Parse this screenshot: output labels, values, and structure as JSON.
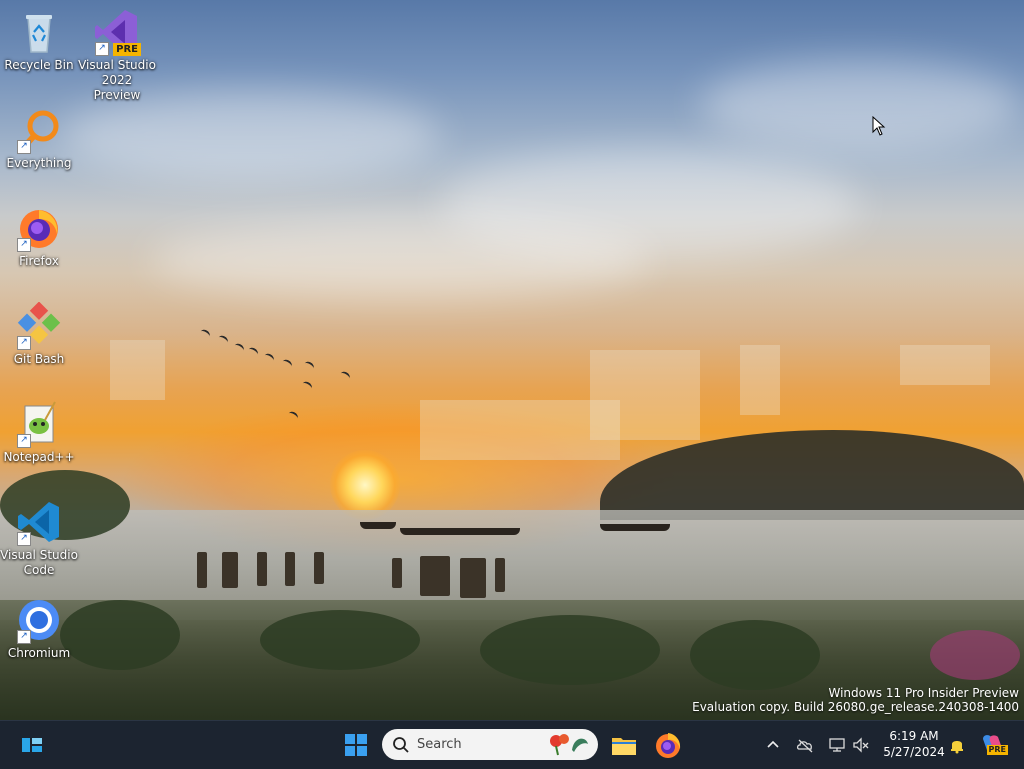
{
  "desktop_icons": [
    {
      "label": "Recycle Bin",
      "icon": "recycle-bin-icon",
      "shortcut": false
    },
    {
      "label": "Visual Studio 2022 Preview",
      "icon": "visual-studio-preview-icon",
      "badge": "PRE",
      "shortcut": true
    },
    {
      "label": "Everything",
      "icon": "everything-search-icon",
      "shortcut": true
    },
    {
      "label": "Firefox",
      "icon": "firefox-icon",
      "shortcut": true
    },
    {
      "label": "Git Bash",
      "icon": "git-bash-icon",
      "shortcut": true
    },
    {
      "label": "Notepad++",
      "icon": "notepad-plus-plus-icon",
      "shortcut": true
    },
    {
      "label": "Visual Studio Code",
      "icon": "vscode-icon",
      "shortcut": true
    },
    {
      "label": "Chromium",
      "icon": "chromium-icon",
      "shortcut": true
    }
  ],
  "watermark": {
    "line1": "Windows 11 Pro Insider Preview",
    "line2": "Evaluation copy. Build 26080.ge_release.240308-1400"
  },
  "taskbar": {
    "search": {
      "placeholder": "Search"
    },
    "pinned": [
      "widgets-icon",
      "start-icon",
      "file-explorer-icon",
      "firefox-icon"
    ],
    "tray": [
      "show-hidden-icons-chevron",
      "onedrive-icon",
      "network-icon",
      "volume-muted-icon",
      "notification-bell-icon",
      "copilot-icon"
    ],
    "clock": {
      "time": "6:19 AM",
      "date": "5/27/2024"
    },
    "copilot_badge": "PRE"
  },
  "colors": {
    "taskbar_bg": "#1c2430",
    "accent": "#0078d4"
  }
}
